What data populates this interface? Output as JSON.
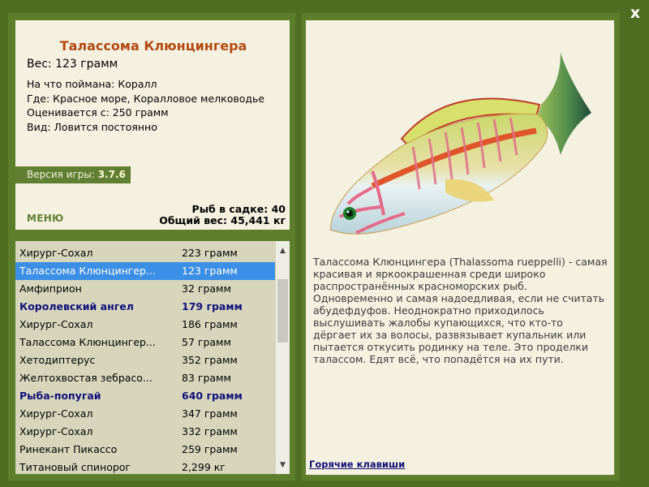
{
  "close_glyph": "x",
  "fish": {
    "title": "Талассома Клюнцингера",
    "weight": "Вес: 123 грамм",
    "info": [
      "На что поймана: Коралл",
      "Где: Красное море, Коралловое мелководье",
      "Оценивается с: 250 грамм",
      "Вид: Ловится постоянно"
    ],
    "description": "Талассома Клюнцингера (Thalassoma rueppelli) - самая красивая и яркоокрашенная среди широко распространённых красноморских рыб. Одновременно и самая надоедливая, если не считать абудефдуфов. Неоднократно приходилось выслушивать жалобы купающихся, что кто-то дёргает их за волосы, развязывает купальник или пытается откусить родинку на теле. Это проделки талассом. Едят всё, что попадётся на их пути."
  },
  "version": {
    "label": "Версия игры:",
    "value": "3.7.6"
  },
  "menu_label": "МЕНЮ",
  "stats": {
    "count": "Рыб в садке: 40",
    "total_weight": "Общий вес: 45,441 кг"
  },
  "catch_list": [
    {
      "name": "Хирург-Сохал",
      "weight": "223 грамм",
      "state": "normal"
    },
    {
      "name": "Талассома Клюнцингер...",
      "weight": "123 грамм",
      "state": "selected"
    },
    {
      "name": "Амфиприон",
      "weight": "32 грамм",
      "state": "normal"
    },
    {
      "name": "Королевский ангел",
      "weight": "179 грамм",
      "state": "highlight"
    },
    {
      "name": "Хирург-Сохал",
      "weight": "186 грамм",
      "state": "normal"
    },
    {
      "name": "Талассома Клюнцингер...",
      "weight": "57 грамм",
      "state": "normal"
    },
    {
      "name": "Хетодиптерус",
      "weight": "352 грамм",
      "state": "normal"
    },
    {
      "name": "Желтохвостая зебрасо...",
      "weight": "83 грамм",
      "state": "normal"
    },
    {
      "name": "Рыба-попугай",
      "weight": "640 грамм",
      "state": "highlight"
    },
    {
      "name": "Хирург-Сохал",
      "weight": "347 грамм",
      "state": "normal"
    },
    {
      "name": "Хирург-Сохал",
      "weight": "332 грамм",
      "state": "normal"
    },
    {
      "name": "Ринекант Пикассо",
      "weight": "259 грамм",
      "state": "normal"
    },
    {
      "name": "Титановый спинорог",
      "weight": "2,299 кг",
      "state": "normal"
    }
  ],
  "hotkeys_label": "Горячие клавиши",
  "colors": {
    "frame": "#4f6e22",
    "panel": "#f5f1e0",
    "title": "#b34a12",
    "selection": "#3b8fe6",
    "highlight_text": "#10107a"
  }
}
